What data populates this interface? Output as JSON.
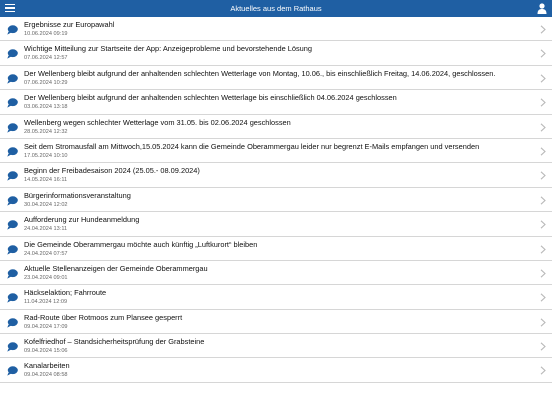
{
  "header": {
    "title": "Aktuelles aus dem Rathaus",
    "menu_icon": "hamburger-menu-icon",
    "user_icon": "user-icon",
    "color": "#1f5fa3"
  },
  "items": [
    {
      "title": "Ergebnisse zur Europawahl",
      "date": "10.06.2024 09:19"
    },
    {
      "title": "Wichtige Mitteilung zur Startseite der App: Anzeigeprobleme und bevorstehende Lösung",
      "date": "07.06.2024 12:57"
    },
    {
      "title": "Der Wellenberg bleibt aufgrund der anhaltenden schlechten Wetterlage von Montag, 10.06., bis einschließlich Freitag, 14.06.2024, geschlossen.",
      "date": "07.06.2024 10:29"
    },
    {
      "title": "Der Wellenberg bleibt aufgrund der anhaltenden schlechten Wetterlage bis einschließlich 04.06.2024 geschlossen",
      "date": "03.06.2024 13:18"
    },
    {
      "title": "Wellenberg wegen schlechter Wetterlage vom 31.05. bis 02.06.2024 geschlossen",
      "date": "28.05.2024 12:32"
    },
    {
      "title": "Seit dem Stromausfall am Mittwoch,15.05.2024 kann die Gemeinde Oberammergau leider nur begrenzt E-Mails empfangen und versenden",
      "date": "17.05.2024 10:10"
    },
    {
      "title": "Beginn der Freibadesaison 2024 (25.05.- 08.09.2024)",
      "date": "14.05.2024 16:11"
    },
    {
      "title": "Bürgerinformationsveranstaltung",
      "date": "30.04.2024 12:02"
    },
    {
      "title": "Aufforderung zur Hundeanmeldung",
      "date": "24.04.2024 13:11"
    },
    {
      "title": "Die Gemeinde Oberammergau möchte auch künftig „Luftkurort“ bleiben",
      "date": "24.04.2024 07:57"
    },
    {
      "title": "Aktuelle Stellenanzeigen der Gemeinde Oberammergau",
      "date": "23.04.2024 09:01"
    },
    {
      "title": "Häckselaktion; Fahrroute",
      "date": "11.04.2024 12:09"
    },
    {
      "title": "Rad-Route über Rotmoos zum Plansee gesperrt",
      "date": "09.04.2024 17:09"
    },
    {
      "title": "Kofelfriedhof – Standsicherheitsprüfung der Grabsteine",
      "date": "09.04.2024 15:06"
    },
    {
      "title": "Kanalarbeiten",
      "date": "09.04.2024 08:58"
    }
  ],
  "row_icon": "speech-bubble-icon",
  "chevron_icon": "chevron-right-icon",
  "bubble_color": "#1f5fa3"
}
